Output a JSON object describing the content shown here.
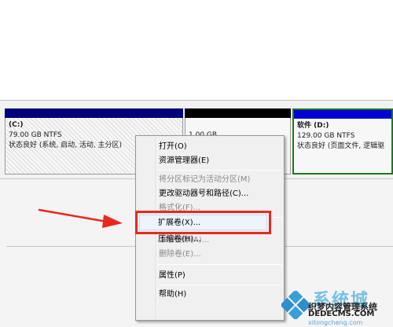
{
  "partitions": {
    "c": {
      "name": "(C:)",
      "size": "79.00 GB NTFS",
      "status": "状态良好 (系统, 启动, 活动, 主分区)"
    },
    "e": {
      "size": "1.00 GB"
    },
    "d": {
      "name": "软件  (D:)",
      "size": "129.00 GB NTFS",
      "status": "状态良好 (页面文件, 逻辑驱"
    }
  },
  "context_menu": {
    "items": [
      {
        "label": "打开(O)",
        "enabled": true
      },
      {
        "label": "资源管理器(E)",
        "enabled": true
      },
      {
        "label": "将分区标记为活动分区(M)",
        "enabled": false
      },
      {
        "label": "更改驱动器号和路径(C)...",
        "enabled": true
      },
      {
        "label": "格式化(F)...",
        "enabled": false
      },
      {
        "label": "扩展卷(X)...",
        "enabled": true,
        "highlighted": true
      },
      {
        "label": "压缩卷(H)...",
        "enabled": true
      },
      {
        "label": "添加镜像(A)...",
        "enabled": false
      },
      {
        "label": "删除卷(E)...",
        "enabled": false
      },
      {
        "label": "属性(P)",
        "enabled": true
      },
      {
        "label": "帮助(H)",
        "enabled": true
      }
    ]
  },
  "watermark": {
    "title": "系统城",
    "line1": "织梦内容管理系统",
    "line2": "DEDECMS.COM",
    "line3": "xitongcheng.com"
  },
  "colors": {
    "primary_partition_bar": "#00007b",
    "logical_partition_bar": "#0000d0",
    "unallocated_bar": "#000000",
    "selected_border": "#1b7a1b",
    "annotation_red": "#e8281e"
  }
}
